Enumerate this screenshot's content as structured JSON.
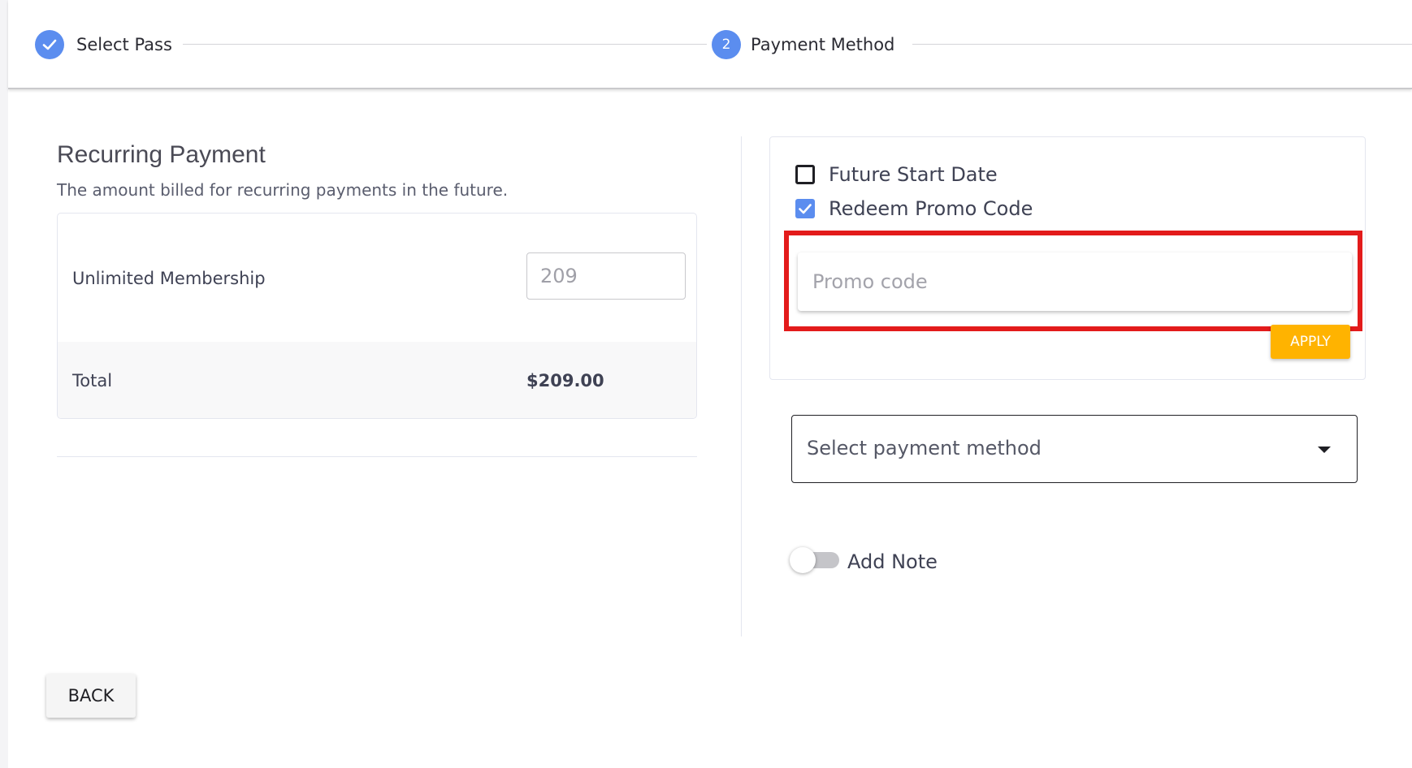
{
  "stepper": {
    "steps": [
      {
        "label": "Select Pass",
        "state": "completed",
        "icon": "check-icon"
      },
      {
        "label": "Payment Method",
        "state": "active",
        "number": "2"
      }
    ]
  },
  "recurring": {
    "title": "Recurring Payment",
    "description": "The amount billed for recurring payments in the future.",
    "item_label": "Unlimited Membership",
    "item_amount": "209",
    "total_label": "Total",
    "total_value": "$209.00"
  },
  "options": {
    "future_start_label": "Future Start Date",
    "future_start_checked": false,
    "promo_label": "Redeem Promo Code",
    "promo_checked": true,
    "promo_placeholder": "Promo code",
    "apply_label": "APPLY"
  },
  "payment": {
    "select_placeholder": "Select payment method"
  },
  "note": {
    "label": "Add Note",
    "enabled": false
  },
  "footer": {
    "back_label": "BACK"
  },
  "colors": {
    "accent": "#5b8def",
    "apply": "#ffb300",
    "highlight": "#e31b1b"
  }
}
